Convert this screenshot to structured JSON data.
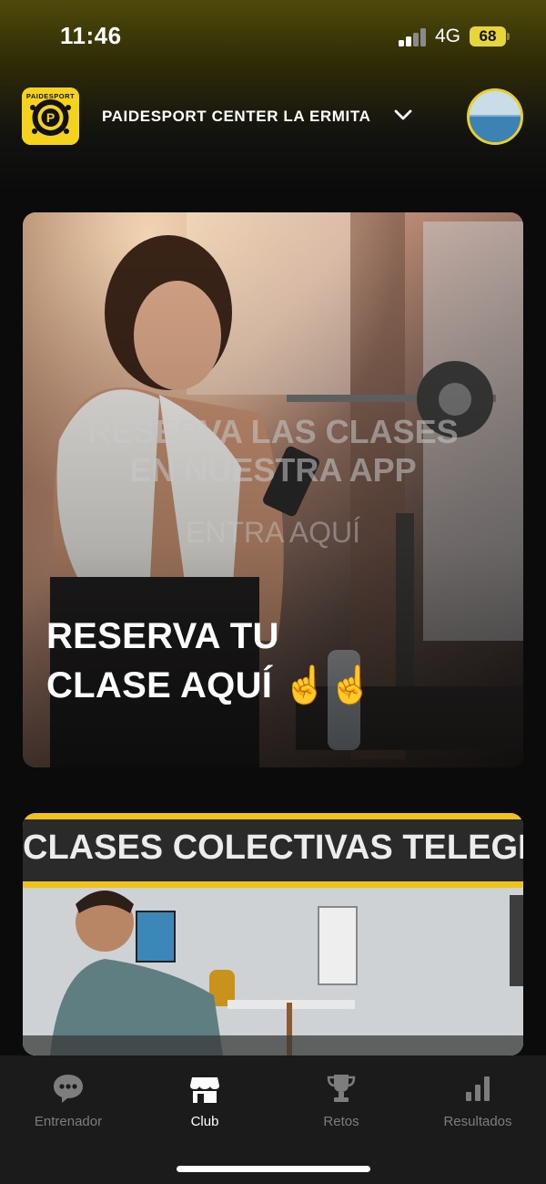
{
  "status_bar": {
    "time": "11:46",
    "network": "4G",
    "battery": "68"
  },
  "header": {
    "club_name": "PAIDESPORT CENTER LA ERMITA",
    "logo_text": "PAIDESPORT",
    "logo_letter": "P"
  },
  "banners": [
    {
      "overlay_line1": "RESERVA LAS CLASES",
      "overlay_line2": "EN NUESTRA APP",
      "overlay_sub": "ENTRA AQUÍ",
      "cta_line1": "RESERVA TU",
      "cta_line2": "CLASE AQUÍ ☝️☝️"
    },
    {
      "title": "CLASES COLECTIVAS TELEGIM"
    }
  ],
  "tabs": [
    {
      "label": "Entrenador",
      "icon": "chat-bubble-icon",
      "active": false
    },
    {
      "label": "Club",
      "icon": "storefront-icon",
      "active": true
    },
    {
      "label": "Retos",
      "icon": "trophy-icon",
      "active": false
    },
    {
      "label": "Resultados",
      "icon": "bar-chart-icon",
      "active": false
    }
  ],
  "colors": {
    "accent": "#F0C21B",
    "header_gradient_top": "#4F4A0A",
    "background": "#0B0B0B",
    "tab_bar": "#1B1B1B",
    "tab_inactive": "#7D7D7D"
  }
}
